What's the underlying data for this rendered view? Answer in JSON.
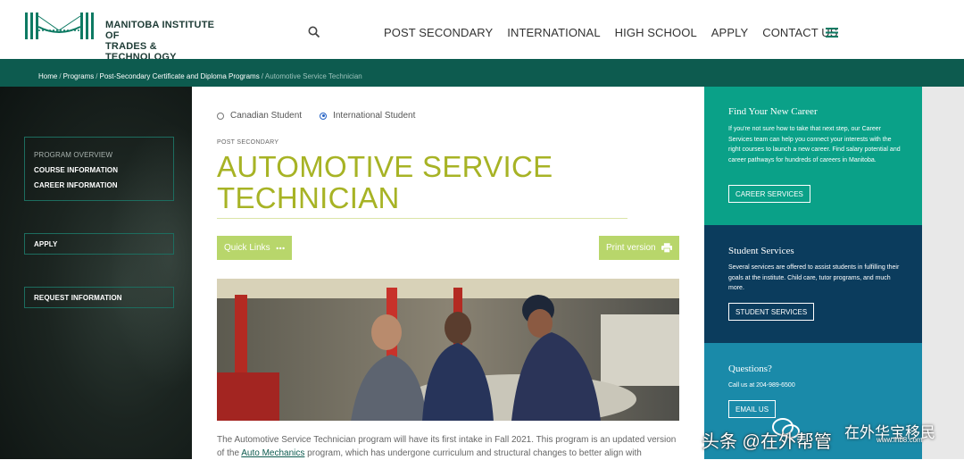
{
  "header": {
    "logo_line1": "MANITOBA INSTITUTE OF",
    "logo_line2": "TRADES & TECHNOLOGY",
    "search_icon": "search-icon",
    "nav": [
      "POST SECONDARY",
      "INTERNATIONAL",
      "HIGH SCHOOL",
      "APPLY",
      "CONTACT US"
    ],
    "menu_icon": "hamburger-menu-icon"
  },
  "breadcrumb": {
    "items": [
      "Home",
      "Programs",
      "Post-Secondary Certificate and Diploma Programs"
    ],
    "current": "Automotive Service Technician"
  },
  "sidebar": {
    "overview": "PROGRAM OVERVIEW",
    "course": "COURSE INFORMATION",
    "career": "CAREER INFORMATION",
    "apply": "APPLY",
    "request": "REQUEST INFORMATION"
  },
  "main": {
    "radio_canadian": "Canadian Student",
    "radio_international": "International Student",
    "selected_radio": "International Student",
    "eyebrow": "POST SECONDARY",
    "title_line1": "AUTOMOTIVE SERVICE",
    "title_line2": "TECHNICIAN",
    "quick_links": "Quick Links",
    "print_version": "Print version",
    "intro_part1": "The Automotive Service Technician program will have its first intake in Fall 2021. This program is an updated version of the ",
    "intro_link": "Auto Mechanics",
    "intro_part2": " program, which has undergone curriculum and structural changes to better align with"
  },
  "panels": {
    "career": {
      "title": "Find Your New Career",
      "text": "If you're not sure how to take that next step, our Career Services team can help you connect your interests with the right courses to launch a new career. Find salary potential and career pathways for hundreds of careers in Manitoba.",
      "button": "CAREER SERVICES"
    },
    "student": {
      "title": "Student Services",
      "text": "Several services are offered to assist students in fulfilling their goals at the institute. Child care, tutor programs, and much more.",
      "button": "STUDENT SERVICES"
    },
    "questions": {
      "title": "Questions?",
      "text": "Call us at 204-989-6500",
      "button": "EMAIL US"
    }
  },
  "watermark": {
    "main": "头条 @在外帮管",
    "sub": "在外华宝移民",
    "url": "www.ihb8.com"
  },
  "colors": {
    "brand_green": "#0d5b4f",
    "title_olive": "#a7b325",
    "button_lime": "#b8d66b",
    "panel_teal": "#0aa188",
    "panel_navy": "#0b3c5d",
    "panel_blue": "#1a8aa9"
  }
}
